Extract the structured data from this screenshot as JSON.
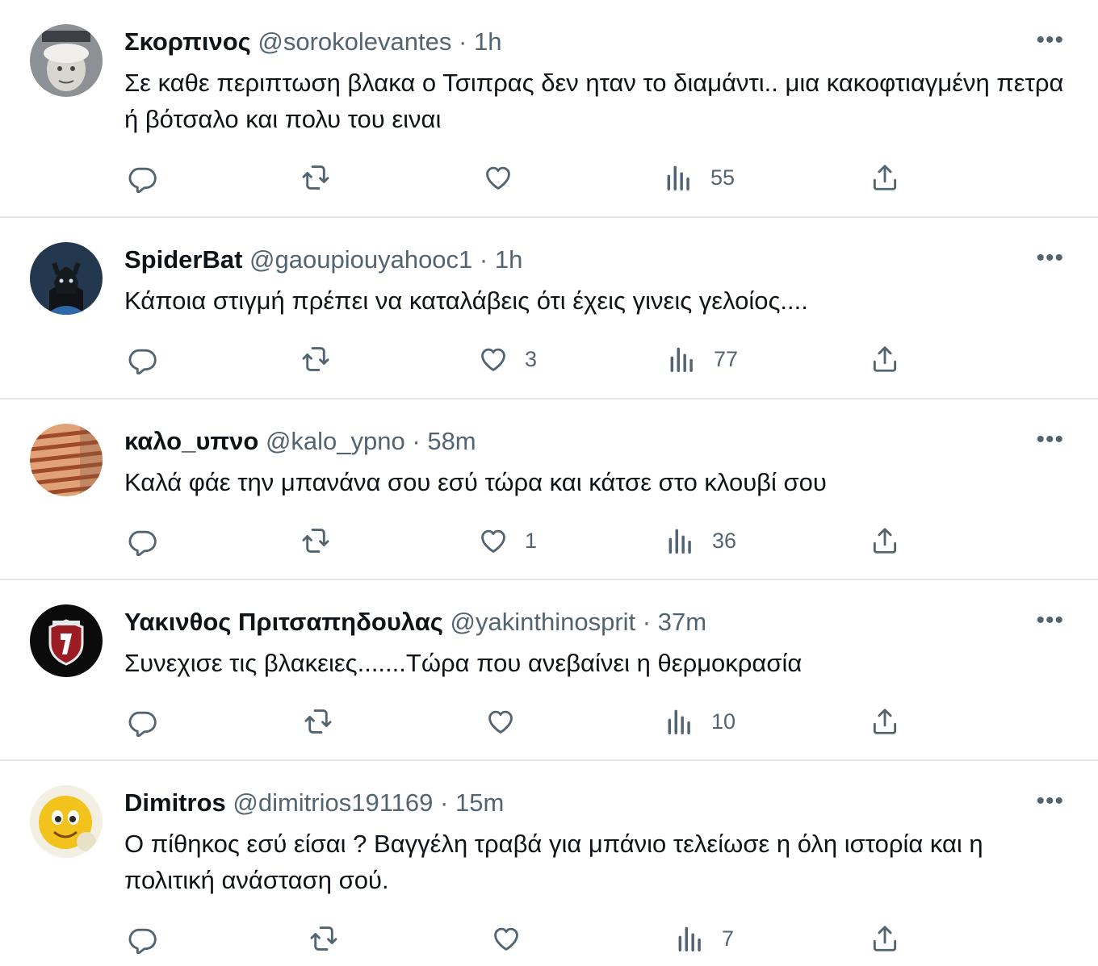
{
  "colors": {
    "text": "#0f1419",
    "secondary": "#536471",
    "divider": "#e3e7ea"
  },
  "icons": {
    "reply": "reply-bubble-icon",
    "retweet": "retweet-arrows-icon",
    "like": "heart-icon",
    "views": "views-bar-chart-icon",
    "share": "share-upload-icon",
    "more": "more-options-dots-icon"
  },
  "more_glyph": "•••",
  "tweets": [
    {
      "name": "Σκορπινος",
      "handle": "@sorokolevantes",
      "sep": "·",
      "time": "1h",
      "text": "Σε καθε περιπτωση βλακα ο Τσιπρας δεν ηταν το διαμάντι.. μια κακοφτιαγμένη πετρα ή βότσαλο και πολυ του ειναι",
      "likes": "",
      "views": "55"
    },
    {
      "name": "SpiderBat",
      "handle": "@gaoupiouyahooc1",
      "sep": "·",
      "time": "1h",
      "text": "Κάποια στιγμή πρέπει να καταλάβεις ότι έχεις γινεις γελοίος....",
      "likes": "3",
      "views": "77"
    },
    {
      "name": "καλο_υπνο",
      "handle": "@kalo_ypno",
      "sep": "·",
      "time": "58m",
      "text": "Καλά φάε την μπανάνα σου εσύ τώρα και κάτσε στο κλουβί σου",
      "likes": "1",
      "views": "36"
    },
    {
      "name": "Υακινθος Πριτσαπηδουλας",
      "handle": "@yakinthinosprit",
      "sep": "·",
      "time": "37m",
      "text": "Συνεχισε τις βλακειες.......Τώρα που ανεβαίνει  η θερμοκρασία",
      "likes": "",
      "views": "10"
    },
    {
      "name": "Dimitros",
      "handle": "@dimitrios191169",
      "sep": "·",
      "time": "15m",
      "text": "Ο πίθηκος εσύ είσαι ? Βαγγέλη τραβά για μπάνιο τελείωσε η όλη ιστορία και η πολιτική ανάσταση σού.",
      "likes": "",
      "views": "7"
    }
  ]
}
